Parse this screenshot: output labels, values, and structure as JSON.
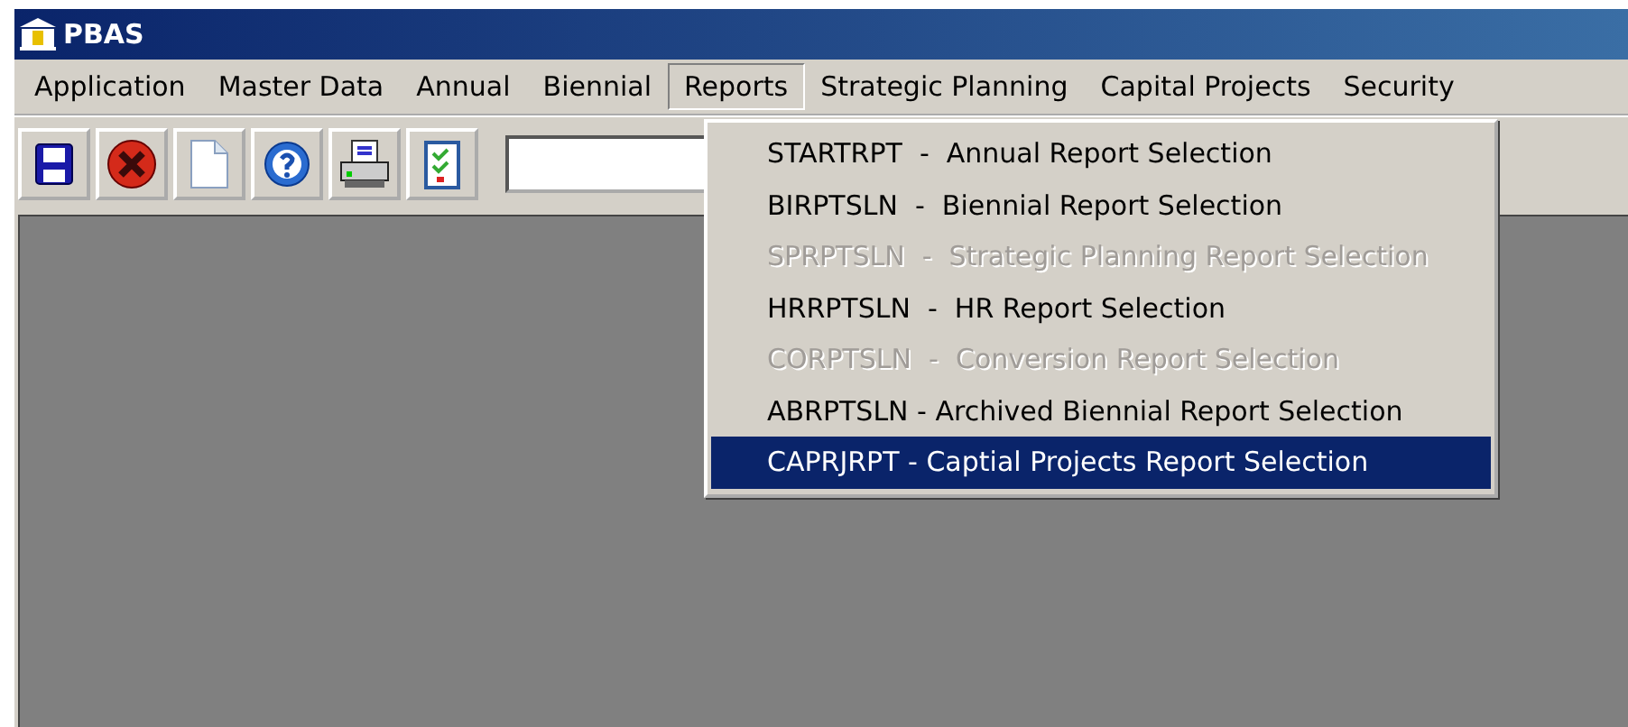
{
  "window": {
    "title": "PBAS"
  },
  "menu_bar": [
    {
      "label": "Application",
      "selected": false
    },
    {
      "label": "Master Data",
      "selected": false
    },
    {
      "label": "Annual",
      "selected": false
    },
    {
      "label": "Biennial",
      "selected": false
    },
    {
      "label": "Reports",
      "selected": true
    },
    {
      "label": "Strategic Planning",
      "selected": false
    },
    {
      "label": "Capital Projects",
      "selected": false
    },
    {
      "label": "Security",
      "selected": false
    }
  ],
  "toolbar": [
    {
      "kind": "save"
    },
    {
      "kind": "cancel"
    },
    {
      "kind": "new"
    },
    {
      "kind": "help"
    },
    {
      "kind": "print"
    },
    {
      "kind": "checklist"
    }
  ],
  "reports_menu": [
    {
      "label": "STARTRPT  -  Annual Report Selection",
      "disabled": false,
      "selected": false
    },
    {
      "label": "BIRPTSLN  -  Biennial Report Selection",
      "disabled": false,
      "selected": false
    },
    {
      "label": "SPRPTSLN  -  Strategic Planning Report Selection",
      "disabled": true,
      "selected": false
    },
    {
      "label": "HRRPTSLN  -  HR Report Selection",
      "disabled": false,
      "selected": false
    },
    {
      "label": "CORPTSLN  -  Conversion Report Selection",
      "disabled": true,
      "selected": false
    },
    {
      "label": "ABRPTSLN - Archived Biennial Report Selection",
      "disabled": false,
      "selected": false
    },
    {
      "label": "CAPRJRPT - Captial Projects Report Selection",
      "disabled": false,
      "selected": true
    }
  ]
}
